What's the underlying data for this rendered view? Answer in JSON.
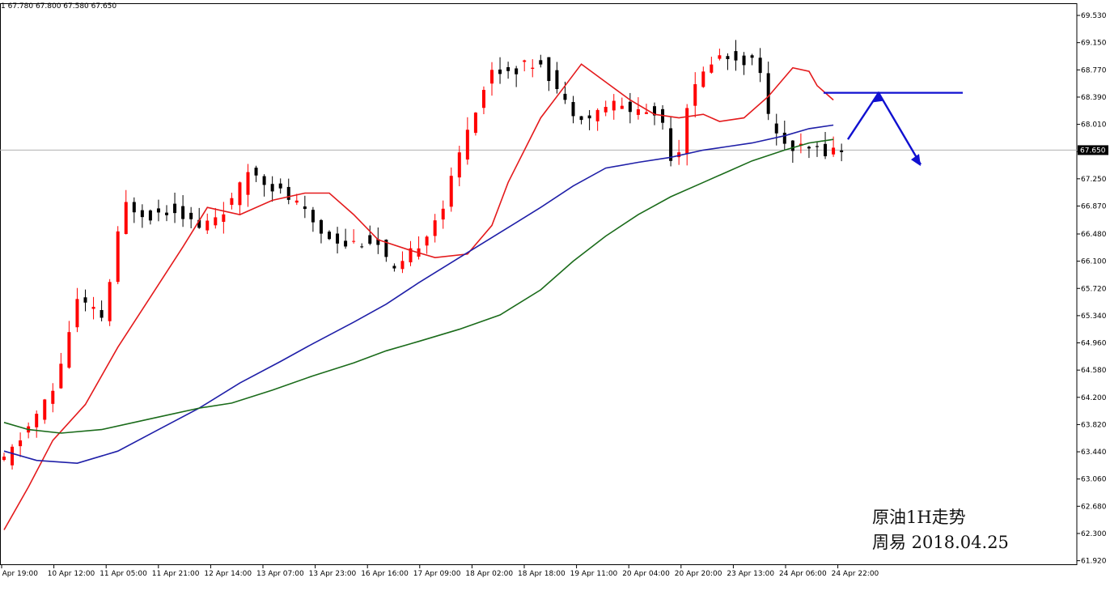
{
  "window": {
    "ohlc_readout": "1  67.780 67.800 67.580 67.650",
    "current_price_label": "67.650"
  },
  "annotation": {
    "line1": "原油1H走势",
    "line2": "周易  2018.04.25"
  },
  "chart_data": {
    "type": "candlestick",
    "title": "",
    "ylim": [
      61.92,
      69.53
    ],
    "y_ticks": [
      "69.530",
      "69.150",
      "68.770",
      "68.390",
      "68.010",
      "67.630",
      "67.250",
      "66.870",
      "66.480",
      "66.100",
      "65.720",
      "65.340",
      "64.960",
      "64.580",
      "64.200",
      "63.820",
      "63.440",
      "63.060",
      "62.680",
      "62.300",
      "61.920"
    ],
    "x_tick_labels": [
      "9 Apr 19:00",
      "10 Apr 12:00",
      "11 Apr 05:00",
      "11 Apr 21:00",
      "12 Apr 14:00",
      "13 Apr 07:00",
      "13 Apr 23:00",
      "16 Apr 16:00",
      "17 Apr 09:00",
      "18 Apr 02:00",
      "18 Apr 18:00",
      "19 Apr 11:00",
      "20 Apr 04:00",
      "20 Apr 20:00",
      "23 Apr 13:00",
      "24 Apr 06:00",
      "24 Apr 22:00"
    ],
    "current_price": 67.65,
    "colors": {
      "up": "#ff0000",
      "down": "#000000",
      "ma_fast": "#e41a1c",
      "ma_mid": "#1f1fa8",
      "ma_slow": "#1a6b1a",
      "projection": "#1010d0",
      "price_line": "#b0b0b0"
    },
    "price_path": [
      {
        "t": "9 Apr 19:00",
        "p": 63.3
      },
      {
        "t": "10 Apr 12:00",
        "p": 64.3
      },
      {
        "t": "10 Apr 20:00",
        "p": 65.55
      },
      {
        "t": "11 Apr 05:00",
        "p": 65.3
      },
      {
        "t": "11 Apr 12:00",
        "p": 66.9
      },
      {
        "t": "11 Apr 21:00",
        "p": 66.75
      },
      {
        "t": "12 Apr 06:00",
        "p": 66.85
      },
      {
        "t": "12 Apr 14:00",
        "p": 66.55
      },
      {
        "t": "13 Apr 02:00",
        "p": 66.95
      },
      {
        "t": "13 Apr 07:00",
        "p": 67.4
      },
      {
        "t": "13 Apr 23:00",
        "p": 66.9
      },
      {
        "t": "16 Apr 08:00",
        "p": 66.5
      },
      {
        "t": "16 Apr 16:00",
        "p": 66.35
      },
      {
        "t": "17 Apr 02:00",
        "p": 66.4
      },
      {
        "t": "17 Apr 09:00",
        "p": 65.9
      },
      {
        "t": "17 Apr 18:00",
        "p": 66.4
      },
      {
        "t": "18 Apr 02:00",
        "p": 66.9
      },
      {
        "t": "18 Apr 10:00",
        "p": 68.0
      },
      {
        "t": "18 Apr 18:00",
        "p": 68.75
      },
      {
        "t": "19 Apr 04:00",
        "p": 68.8
      },
      {
        "t": "19 Apr 11:00",
        "p": 68.9
      },
      {
        "t": "19 Apr 20:00",
        "p": 68.25
      },
      {
        "t": "20 Apr 04:00",
        "p": 68.1
      },
      {
        "t": "20 Apr 10:00",
        "p": 68.3
      },
      {
        "t": "20 Apr 20:00",
        "p": 68.2
      },
      {
        "t": "23 Apr 04:00",
        "p": 68.15
      },
      {
        "t": "23 Apr 09:00",
        "p": 67.35
      },
      {
        "t": "23 Apr 13:00",
        "p": 68.3
      },
      {
        "t": "23 Apr 22:00",
        "p": 68.95
      },
      {
        "t": "24 Apr 06:00",
        "p": 68.95
      },
      {
        "t": "24 Apr 14:00",
        "p": 68.85
      },
      {
        "t": "24 Apr 18:00",
        "p": 67.85
      },
      {
        "t": "24 Apr 22:00",
        "p": 67.8
      },
      {
        "t": "25 Apr 01:00",
        "p": 67.65
      }
    ],
    "series": [
      {
        "color": "#e41a1c",
        "points": [
          [
            0,
            62.35
          ],
          [
            3,
            62.95
          ],
          [
            6,
            63.6
          ],
          [
            10,
            64.1
          ],
          [
            14,
            64.9
          ],
          [
            18,
            65.6
          ],
          [
            22,
            66.3
          ],
          [
            25,
            66.85
          ],
          [
            29,
            66.75
          ],
          [
            33,
            66.95
          ],
          [
            37,
            67.05
          ],
          [
            40,
            67.05
          ],
          [
            43,
            66.75
          ],
          [
            46,
            66.4
          ],
          [
            50,
            66.25
          ],
          [
            53,
            66.15
          ],
          [
            57,
            66.2
          ],
          [
            60,
            66.6
          ],
          [
            62,
            67.2
          ],
          [
            66,
            68.1
          ],
          [
            69,
            68.55
          ],
          [
            71,
            68.85
          ],
          [
            74,
            68.6
          ],
          [
            77,
            68.35
          ],
          [
            80,
            68.15
          ],
          [
            83,
            68.1
          ],
          [
            86,
            68.15
          ],
          [
            88,
            68.05
          ],
          [
            91,
            68.1
          ],
          [
            94,
            68.4
          ],
          [
            97,
            68.8
          ],
          [
            99,
            68.75
          ],
          [
            100,
            68.55
          ],
          [
            102,
            68.35
          ]
        ]
      },
      {
        "color": "#1f1fa8",
        "points": [
          [
            0,
            63.45
          ],
          [
            4,
            63.32
          ],
          [
            9,
            63.28
          ],
          [
            14,
            63.45
          ],
          [
            19,
            63.75
          ],
          [
            24,
            64.05
          ],
          [
            29,
            64.4
          ],
          [
            34,
            64.7
          ],
          [
            38,
            64.95
          ],
          [
            43,
            65.25
          ],
          [
            47,
            65.5
          ],
          [
            51,
            65.8
          ],
          [
            56,
            66.15
          ],
          [
            61,
            66.5
          ],
          [
            66,
            66.85
          ],
          [
            70,
            67.15
          ],
          [
            74,
            67.4
          ],
          [
            78,
            67.48
          ],
          [
            82,
            67.55
          ],
          [
            86,
            67.65
          ],
          [
            89,
            67.7
          ],
          [
            92,
            67.75
          ],
          [
            96,
            67.85
          ],
          [
            99,
            67.95
          ],
          [
            102,
            68.0
          ]
        ]
      },
      {
        "color": "#1a6b1a",
        "points": [
          [
            0,
            63.85
          ],
          [
            3,
            63.75
          ],
          [
            7,
            63.7
          ],
          [
            12,
            63.75
          ],
          [
            18,
            63.9
          ],
          [
            24,
            64.05
          ],
          [
            28,
            64.12
          ],
          [
            33,
            64.3
          ],
          [
            38,
            64.5
          ],
          [
            43,
            64.68
          ],
          [
            47,
            64.85
          ],
          [
            51,
            64.98
          ],
          [
            56,
            65.15
          ],
          [
            61,
            65.35
          ],
          [
            66,
            65.7
          ],
          [
            70,
            66.1
          ],
          [
            74,
            66.45
          ],
          [
            78,
            66.75
          ],
          [
            82,
            67.0
          ],
          [
            86,
            67.2
          ],
          [
            89,
            67.35
          ],
          [
            92,
            67.5
          ],
          [
            96,
            67.65
          ],
          [
            99,
            67.75
          ],
          [
            102,
            67.8
          ]
        ]
      }
    ],
    "resistance_level": 68.45,
    "projection_path": [
      67.8,
      68.45,
      67.45
    ]
  }
}
